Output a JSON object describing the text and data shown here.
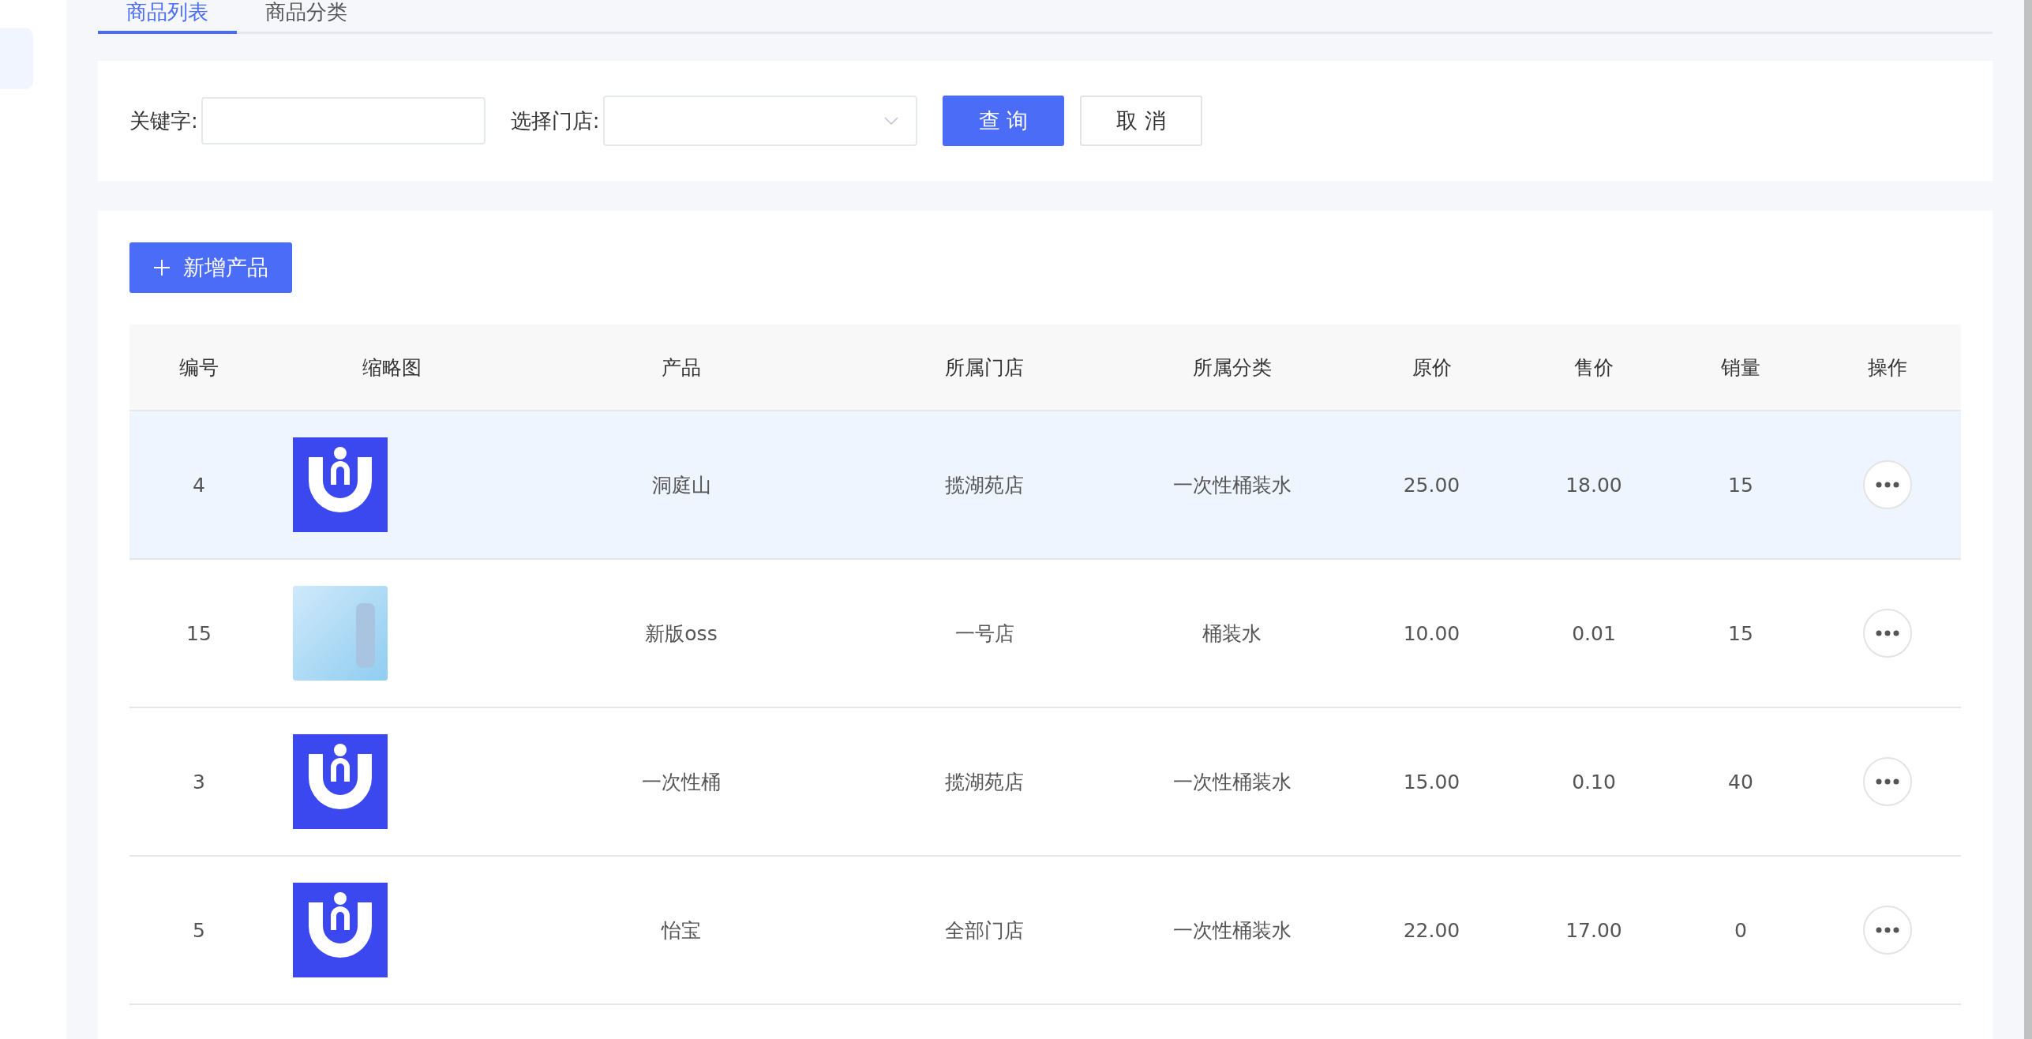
{
  "tabs": [
    {
      "label": "商品列表",
      "selected": true
    },
    {
      "label": "商品分类",
      "selected": false
    }
  ],
  "filters": {
    "keyword": {
      "label": "关键字:"
    },
    "store": {
      "label": "选择门店:"
    },
    "buttons": [
      {
        "label": "查 询",
        "kind": "primary"
      },
      {
        "label": "取 消",
        "kind": "default"
      }
    ]
  },
  "add_button": {
    "label": "新增产品"
  },
  "table": {
    "columns": [
      "编号",
      "缩略图",
      "产品",
      "所属门店",
      "所属分类",
      "原价",
      "售价",
      "销量",
      "操作"
    ],
    "rows": [
      {
        "id": "4",
        "thumbnail": {
          "kind": "logo"
        },
        "product": "洞庭山",
        "store": "揽湖苑店",
        "category": "一次性桶装水",
        "original_price": "25.00",
        "price": "18.00",
        "sales": "15",
        "selected": true
      },
      {
        "id": "15",
        "thumbnail": {
          "kind": "photo"
        },
        "product": "新版oss",
        "store": "一号店",
        "category": "桶装水",
        "original_price": "10.00",
        "price": "0.01",
        "sales": "15",
        "selected": false
      },
      {
        "id": "3",
        "thumbnail": {
          "kind": "logo"
        },
        "product": "一次性桶",
        "store": "揽湖苑店",
        "category": "一次性桶装水",
        "original_price": "15.00",
        "price": "0.10",
        "sales": "40",
        "selected": false
      },
      {
        "id": "5",
        "thumbnail": {
          "kind": "logo"
        },
        "product": "怡宝",
        "store": "全部门店",
        "category": "一次性桶装水",
        "original_price": "22.00",
        "price": "17.00",
        "sales": "0",
        "selected": false
      }
    ]
  }
}
